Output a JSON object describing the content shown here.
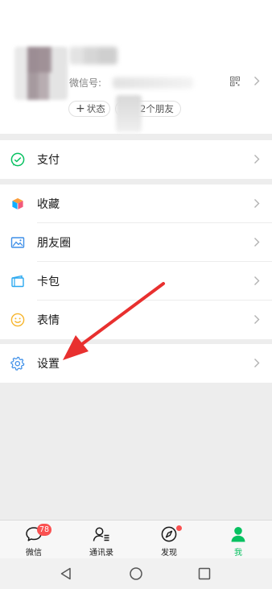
{
  "profile": {
    "wxid_label": "微信号:",
    "status_label": "状态",
    "friends_label": "2个朋友"
  },
  "menu": {
    "pay": {
      "label": "支付",
      "icon": "wechat-pay-icon"
    },
    "favorites": {
      "label": "收藏",
      "icon": "cube-icon"
    },
    "moments": {
      "label": "朋友圈",
      "icon": "picture-icon"
    },
    "cards": {
      "label": "卡包",
      "icon": "wallet-icon"
    },
    "stickers": {
      "label": "表情",
      "icon": "smiley-icon"
    },
    "settings": {
      "label": "设置",
      "icon": "gear-icon"
    }
  },
  "tabbar": {
    "chats": {
      "label": "微信",
      "badge": "78"
    },
    "contacts": {
      "label": "通讯录"
    },
    "discover": {
      "label": "发现"
    },
    "me": {
      "label": "我"
    }
  },
  "colors": {
    "brand_green": "#07c160",
    "badge_red": "#fa5151",
    "annotation_red": "#e8302f",
    "background": "#ededed"
  }
}
